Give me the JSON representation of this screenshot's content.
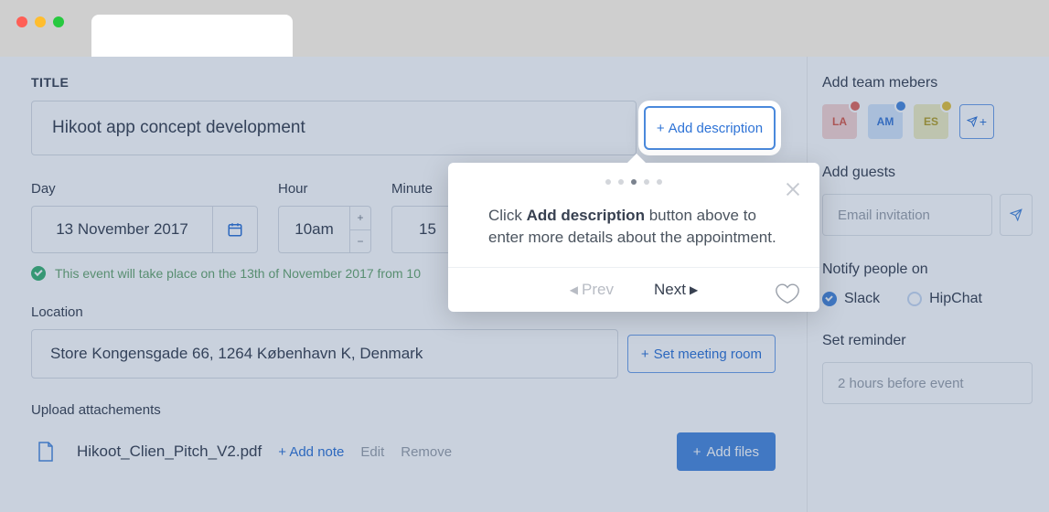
{
  "labels": {
    "title": "TITLE",
    "day": "Day",
    "hour": "Hour",
    "minute": "Minute",
    "location": "Location",
    "upload": "Upload attachements",
    "team": "Add team mebers",
    "guests": "Add guests",
    "notify": "Notify people on",
    "reminder": "Set reminder"
  },
  "form": {
    "title": "Hikoot app concept development",
    "day": "13 November 2017",
    "hour": "10am",
    "minute": "15",
    "event_note": "This event will take place on the 13th of November 2017 from 10",
    "location": "Store Kongensgade 66, 1264 København K, Denmark",
    "file_name": "Hikoot_Clien_Pitch_V2.pdf",
    "guest_placeholder": "Email invitation",
    "reminder_placeholder": "2 hours before event"
  },
  "buttons": {
    "add_desc": "Add description",
    "set_meeting": "Set meeting room",
    "add_files": "Add files",
    "add_note": "+ Add note",
    "edit": "Edit",
    "remove": "Remove"
  },
  "team": [
    {
      "initials": "LA",
      "badge": "red"
    },
    {
      "initials": "AM",
      "badge": "blue"
    },
    {
      "initials": "ES",
      "badge": "yellow"
    }
  ],
  "notify": {
    "opt1": "Slack",
    "opt2": "HipChat"
  },
  "popover": {
    "text_pre": "Click ",
    "text_bold": "Add description",
    "text_post": " button above to enter more details about the appointment.",
    "prev": "Prev",
    "next": "Next",
    "active_dot": 2
  }
}
